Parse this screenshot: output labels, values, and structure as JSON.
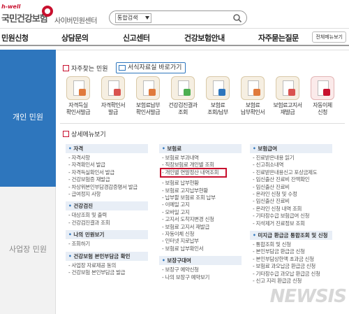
{
  "header": {
    "logo_hwell": "h-well",
    "logo_name": "국민건강보험",
    "logo_center": "사이버민원센터",
    "search_select": "통합검색",
    "search_placeholder": ""
  },
  "gnb": {
    "items": [
      "민원신청",
      "상담문의",
      "신고센터",
      "건강보험안내",
      "자주묻는질문"
    ],
    "all_menu": "전체메뉴보기"
  },
  "side": {
    "personal": "개인 민원",
    "business": "사업장 민원"
  },
  "quick": {
    "title": "자주찾는 민원",
    "form_button": "서식자료실 바로가기",
    "items": [
      {
        "l1": "자격득실",
        "l2": "확인서발급"
      },
      {
        "l1": "자격확인서",
        "l2": "발급"
      },
      {
        "l1": "보험료납부",
        "l2": "확인서발급"
      },
      {
        "l1": "건강검진결과",
        "l2": "조회"
      },
      {
        "l1": "보험료",
        "l2": "조회/납부"
      },
      {
        "l1": "보험료",
        "l2": "납부확인서"
      },
      {
        "l1": "보험료고지서",
        "l2": "재발급"
      },
      {
        "l1": "자동이체",
        "l2": "신청"
      }
    ]
  },
  "detail": {
    "title": "상세메뉴보기",
    "col1": {
      "groups": [
        {
          "cat": "자격",
          "items": [
            "자격사항",
            "자격확인서 발급",
            "자격득실확인서 발급",
            "건강보험증 재발급",
            "차상위본인부담경감증명서 발급",
            "급여정지 사항"
          ]
        },
        {
          "cat": "건강검진",
          "items": [
            "대상조회 및 출력",
            "건강검진결과 조회"
          ]
        },
        {
          "cat": "나의 민원보기",
          "items": [
            "조회하기"
          ]
        },
        {
          "cat": "건강보험 본인부담금 확인",
          "items": [
            "사업장 자료제공 동의",
            "건강보험 본인부담금 발급"
          ]
        }
      ]
    },
    "col2": {
      "groups": [
        {
          "cat": "보험료",
          "items": [
            "보험료 부과내역",
            "직장보험료 개인별 조회",
            "개인별 연말정산 내역조회",
            "보험료 납부현황",
            "보험료 고지납부현황",
            "납부할 보험료 조회 납부",
            "이메일 고지",
            "모바일 고지",
            "고지서 도착지변경 신청",
            "보험료 고지서 재발급",
            "자동이체 신청",
            "인터넷 지로납부",
            "보험료 납부확인서"
          ]
        },
        {
          "cat": "보장구대여",
          "items": [
            "보장구 예약신청",
            "나의 보장구 예약보기"
          ]
        }
      ]
    },
    "col3": {
      "groups": [
        {
          "cat": "보험급여",
          "items": [
            "진료받은내용 읽기",
            "신고취소내역",
            "진료받은내용신고 포상금제도",
            "임신출산 진료비 잔액확인",
            "임신출산 진료비",
            "온라인 신청 및 수정",
            "임신출산 진료비",
            "온라인 신청 내역 조회",
            "기타장수급 보험급여 신청",
            "지석제거 진료정보 조회"
          ]
        },
        {
          "cat": "미지급 환급금 통합조회 및 신청",
          "items": [
            "통합조회 및 신청",
            "본인부담금 환급금 신청",
            "본인부담상한액 초과금 신청",
            "보험료 과오납금 환급금 신청",
            "기타장수급 과오납 환급금 신청",
            "신고 지리 환급금 신청"
          ]
        }
      ]
    }
  },
  "watermark": "NEWSIS"
}
